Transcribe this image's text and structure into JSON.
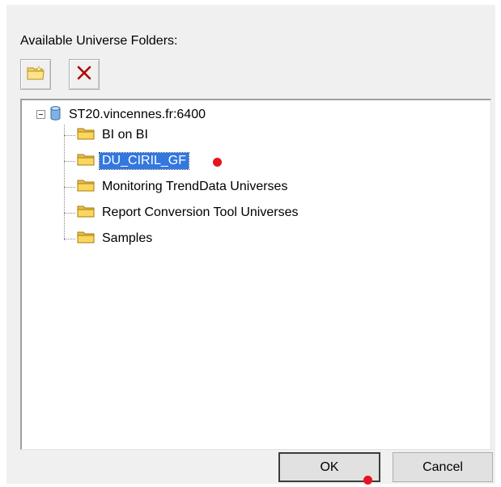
{
  "dialog": {
    "folders_label": "Available Universe Folders:"
  },
  "toolbar": {
    "new_folder_icon": "folder-new-icon",
    "delete_icon": "delete-x-icon",
    "delete_color": "#b00000"
  },
  "tree": {
    "server": {
      "label": "ST20.vincennes.fr:6400",
      "icon": "database-server-icon",
      "expanded": true
    },
    "folders": [
      {
        "label": "BI on BI",
        "selected": false
      },
      {
        "label": "DU_CIRIL_GF",
        "selected": true
      },
      {
        "label": "Monitoring TrendData Universes",
        "selected": false
      },
      {
        "label": "Report Conversion Tool Universes",
        "selected": false
      },
      {
        "label": "Samples",
        "selected": false
      }
    ],
    "selection_color": "#3377e0"
  },
  "buttons": {
    "ok_label": "OK",
    "cancel_label": "Cancel"
  },
  "markers": {
    "color": "#e8131c"
  }
}
